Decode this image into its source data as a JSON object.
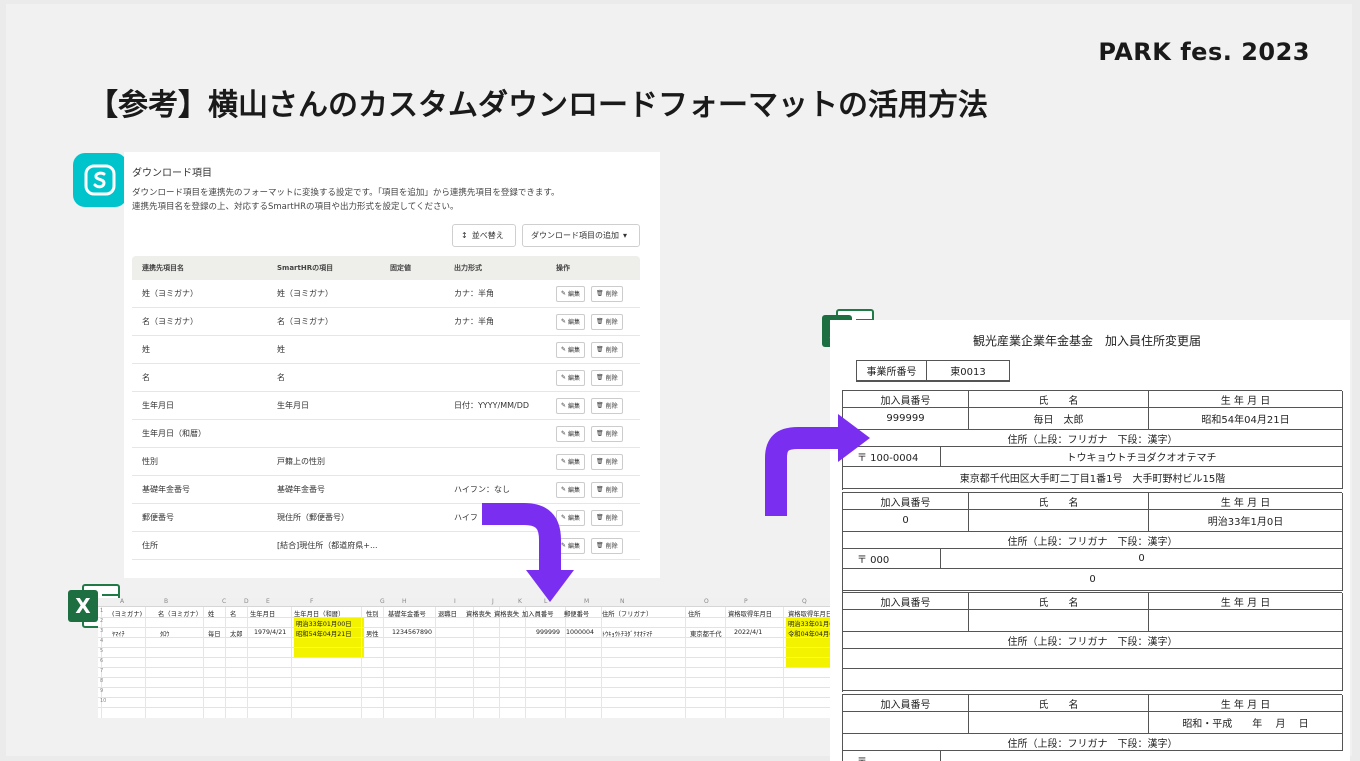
{
  "slide": {
    "brand": "PARK fes. 2023",
    "title": "【参考】横山さんのカスタムダウンロードフォーマットの活用方法"
  },
  "smarthr": {
    "logo_icon": "smarthr-logo-icon",
    "heading": "ダウンロード項目",
    "desc1": "ダウンロード項目を連携先のフォーマットに変換する設定です。「項目を追加」から連携先項目を登録できます。",
    "desc2": "連携先項目名を登録の上、対応するSmartHRの項目や出力形式を設定してください。",
    "sort_label": "並べ替え",
    "add_label": "ダウンロード項目の追加",
    "headers": [
      "連携先項目名",
      "SmartHRの項目",
      "固定値",
      "出力形式",
      "操作"
    ],
    "edit_label": "編集",
    "delete_label": "削除",
    "rows": [
      {
        "name": "姓（ヨミガナ）",
        "item": "姓（ヨミガナ）",
        "fmt": "カナ：半角"
      },
      {
        "name": "名（ヨミガナ）",
        "item": "名（ヨミガナ）",
        "fmt": "カナ：半角"
      },
      {
        "name": "姓",
        "item": "姓",
        "fmt": ""
      },
      {
        "name": "名",
        "item": "名",
        "fmt": ""
      },
      {
        "name": "生年月日",
        "item": "生年月日",
        "fmt": "日付：YYYY/MM/DD"
      },
      {
        "name": "生年月日（和暦）",
        "item": "",
        "fmt": ""
      },
      {
        "name": "性別",
        "item": "戸籍上の性別",
        "fmt": ""
      },
      {
        "name": "基礎年金番号",
        "item": "基礎年金番号",
        "fmt": "ハイフン：なし"
      },
      {
        "name": "郵便番号",
        "item": "現住所（郵便番号）",
        "fmt": "ハイフ"
      },
      {
        "name": "住所",
        "item": "[結合]現住所（都道府県+...",
        "fmt": ""
      }
    ]
  },
  "sheet": {
    "columns": [
      "A",
      "B",
      "C",
      "D",
      "E",
      "F",
      "G",
      "H",
      "I",
      "J",
      "K",
      "L",
      "M",
      "N",
      "O",
      "P",
      "Q",
      "R",
      "S",
      "T"
    ],
    "header_cells": [
      "(ヨミガナ)",
      "名（ヨミガナ）",
      "姓",
      "名",
      "生年月日",
      "生年月日（和暦）",
      "性別",
      "基礎年金番号",
      "退職日",
      "資格喪失",
      "資格喪失",
      "加入員番号",
      "郵便番号",
      "住所（フリガナ）",
      "住所",
      "資格取得年月日",
      "資格取得年月日",
      "報酬月額",
      "標準報酬月額",
      "標準報酬月額",
      "備"
    ],
    "highlight1": "明治33年01月00日",
    "highlight2": "明治33年01月00日",
    "data_cells": [
      "ﾔﾏｲﾁ",
      "ﾀﾛｳ",
      "毎日",
      "太郎",
      "1979/4/21",
      "昭和54年04月21日",
      "男性",
      "1234567890",
      "999999",
      "1000004",
      "ﾄｳｷｮｳﾄﾁﾖﾀﾞｸｵｵﾃﾏﾁ",
      "東京都千代",
      "2022/4/1",
      "令和04年04月01日",
      "300000"
    ]
  },
  "form": {
    "title": "観光産業企業年金基金　加入員住所変更届",
    "office_label": "事業所番号",
    "office_value": "東0013",
    "member_no": "加入員番号",
    "name_label": "氏　　名",
    "birth_label": "生 年 月 日",
    "address_label": "住所（上段：フリガナ　下段：漢字）",
    "rec1_no": "999999",
    "rec1_name": "毎日　太郎",
    "rec1_birth": "昭和54年04月21日",
    "rec1_zip": "〒 100-0004",
    "rec1_kana": "トウキョウトチヨダクオオテマチ",
    "rec1_addr": "東京都千代田区大手町二丁目1番1号　大手町野村ビル15階",
    "rec2_no": "0",
    "rec2_birth": "明治33年1月0日",
    "rec2_zip": "〒 000",
    "rec2_kana": "0",
    "rec2_addr": "0",
    "rec4_birth": "昭和・平成　　年　 月　 日",
    "rec4_zip": "〒"
  },
  "colors": {
    "smarthr": "#00c4cc",
    "excel": "#1d6f42",
    "arrow": "#7a2ff0",
    "highlight": "#f3f300"
  }
}
